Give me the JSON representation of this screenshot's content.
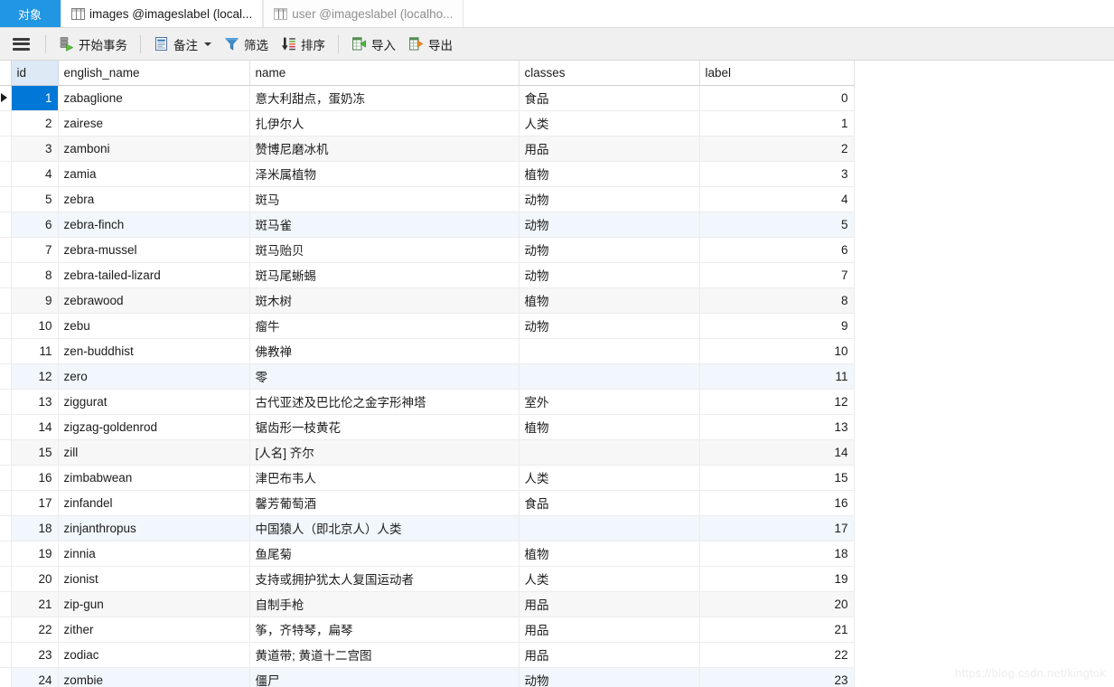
{
  "tabs": [
    {
      "label": "对象",
      "icon": "",
      "state": "objects"
    },
    {
      "label": "images @imageslabel (local...",
      "icon": "table-icon",
      "state": "active"
    },
    {
      "label": "user @imageslabel (localho...",
      "icon": "table-icon",
      "state": "inactive"
    }
  ],
  "toolbar": {
    "menu_icon": "hamburger-menu-icon",
    "items": [
      {
        "label": "开始事务",
        "icon": "begin-transaction-icon",
        "has_caret": false
      },
      {
        "label": "备注",
        "icon": "note-icon",
        "has_caret": true
      },
      {
        "label": "筛选",
        "icon": "filter-icon",
        "has_caret": false
      },
      {
        "label": "排序",
        "icon": "sort-icon",
        "has_caret": false
      },
      {
        "label": "导入",
        "icon": "import-icon",
        "has_caret": false
      },
      {
        "label": "导出",
        "icon": "export-icon",
        "has_caret": false
      }
    ]
  },
  "grid": {
    "columns": [
      "id",
      "english_name",
      "name",
      "classes",
      "label"
    ],
    "selected_cell": {
      "row": 0,
      "column": "id"
    },
    "rows": [
      {
        "id": "1",
        "english_name": "zabaglione",
        "name": "意大利甜点，蛋奶冻",
        "classes": "食品",
        "label": "0"
      },
      {
        "id": "2",
        "english_name": "zairese",
        "name": "扎伊尔人",
        "classes": "人类",
        "label": "1"
      },
      {
        "id": "3",
        "english_name": "zamboni",
        "name": "赞博尼磨冰机",
        "classes": "用品",
        "label": "2"
      },
      {
        "id": "4",
        "english_name": "zamia",
        "name": "泽米属植物",
        "classes": "植物",
        "label": "3"
      },
      {
        "id": "5",
        "english_name": "zebra",
        "name": "斑马",
        "classes": "动物",
        "label": "4"
      },
      {
        "id": "6",
        "english_name": "zebra-finch",
        "name": "斑马雀",
        "classes": "动物",
        "label": "5"
      },
      {
        "id": "7",
        "english_name": "zebra-mussel",
        "name": "斑马贻贝",
        "classes": "动物",
        "label": "6"
      },
      {
        "id": "8",
        "english_name": "zebra-tailed-lizard",
        "name": "斑马尾蜥蜴",
        "classes": "动物",
        "label": "7"
      },
      {
        "id": "9",
        "english_name": "zebrawood",
        "name": "斑木树",
        "classes": "植物",
        "label": "8"
      },
      {
        "id": "10",
        "english_name": "zebu",
        "name": "瘤牛",
        "classes": "动物",
        "label": "9"
      },
      {
        "id": "11",
        "english_name": "zen-buddhist",
        "name": "佛教禅",
        "classes": "",
        "label": "10"
      },
      {
        "id": "12",
        "english_name": "zero",
        "name": "零",
        "classes": "",
        "label": "11"
      },
      {
        "id": "13",
        "english_name": "ziggurat",
        "name": "古代亚述及巴比伦之金字形神塔",
        "classes": "室外",
        "label": "12"
      },
      {
        "id": "14",
        "english_name": "zigzag-goldenrod",
        "name": "锯齿形一枝黄花",
        "classes": "植物",
        "label": "13"
      },
      {
        "id": "15",
        "english_name": "zill",
        "name": "[人名] 齐尔",
        "classes": "",
        "label": "14"
      },
      {
        "id": "16",
        "english_name": "zimbabwean",
        "name": "津巴布韦人",
        "classes": "人类",
        "label": "15"
      },
      {
        "id": "17",
        "english_name": "zinfandel",
        "name": "馨芳葡萄酒",
        "classes": "食品",
        "label": "16"
      },
      {
        "id": "18",
        "english_name": "zinjanthropus",
        "name": "中国猿人（即北京人）人类",
        "classes": "",
        "label": "17"
      },
      {
        "id": "19",
        "english_name": "zinnia",
        "name": "鱼尾菊",
        "classes": "植物",
        "label": "18"
      },
      {
        "id": "20",
        "english_name": "zionist",
        "name": "支持或拥护犹太人复国运动者",
        "classes": "人类",
        "label": "19"
      },
      {
        "id": "21",
        "english_name": "zip-gun",
        "name": "自制手枪",
        "classes": "用品",
        "label": "20"
      },
      {
        "id": "22",
        "english_name": "zither",
        "name": "筝，齐特琴，扁琴",
        "classes": "用品",
        "label": "21"
      },
      {
        "id": "23",
        "english_name": "zodiac",
        "name": "黄道带; 黄道十二宫图",
        "classes": "用品",
        "label": "22"
      },
      {
        "id": "24",
        "english_name": "zombie",
        "name": "僵尸",
        "classes": "动物",
        "label": "23"
      }
    ]
  },
  "watermark": "https://blog.csdn.net/kingtok",
  "colors": {
    "tab_accent": "#2196e3",
    "selection": "#0078d7",
    "header_active_column": "#ddeaf6",
    "stripe_gray": "#f7f7f7",
    "stripe_blue": "#f1f7fc"
  }
}
